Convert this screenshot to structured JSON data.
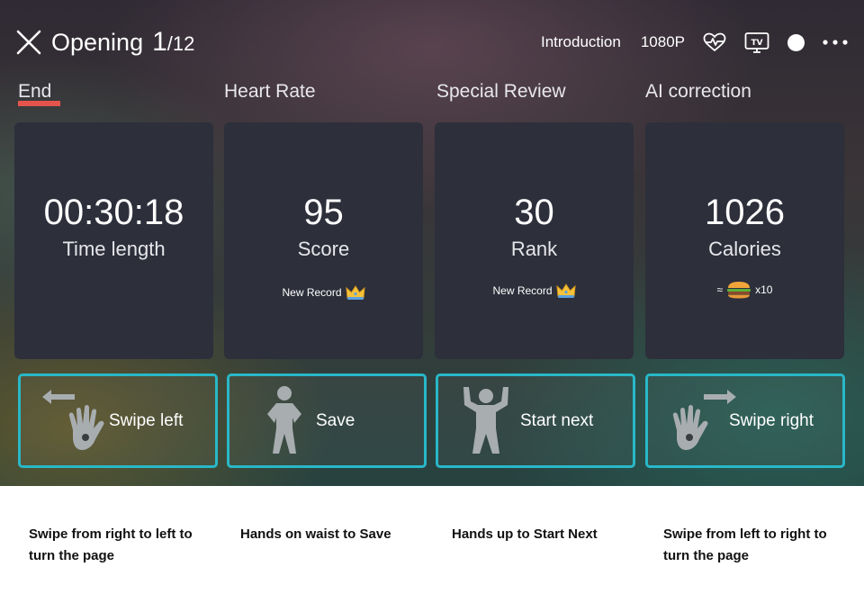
{
  "header": {
    "title": "Opening",
    "current": "1",
    "total": "/12",
    "links": [
      "Introduction",
      "1080P"
    ],
    "icons": [
      "heart-rate-icon",
      "tv-icon",
      "dot-icon",
      "more-icon"
    ]
  },
  "tabs": [
    "End",
    "Heart Rate",
    "Special Review",
    "AI correction"
  ],
  "stats": [
    {
      "value": "00:30:18",
      "label": "Time length",
      "note": ""
    },
    {
      "value": "95",
      "label": "Score",
      "note": "New Record"
    },
    {
      "value": "30",
      "label": "Rank",
      "note": "New Record"
    },
    {
      "value": "1026",
      "label": "Calories",
      "note_prefix": "≈",
      "note_suffix": "x10"
    }
  ],
  "gestures": [
    "Swipe left",
    "Save",
    "Start next",
    "Swipe right"
  ],
  "descriptions": [
    "Swipe from right to left to turn the page",
    "Hands on waist to Save",
    "Hands up to Start Next",
    "Swipe from left to right to turn the page"
  ],
  "colors": {
    "accent_underline": "#e5544c",
    "gesture_border": "#28b8c8",
    "card_bg": "#2d2f3b"
  }
}
